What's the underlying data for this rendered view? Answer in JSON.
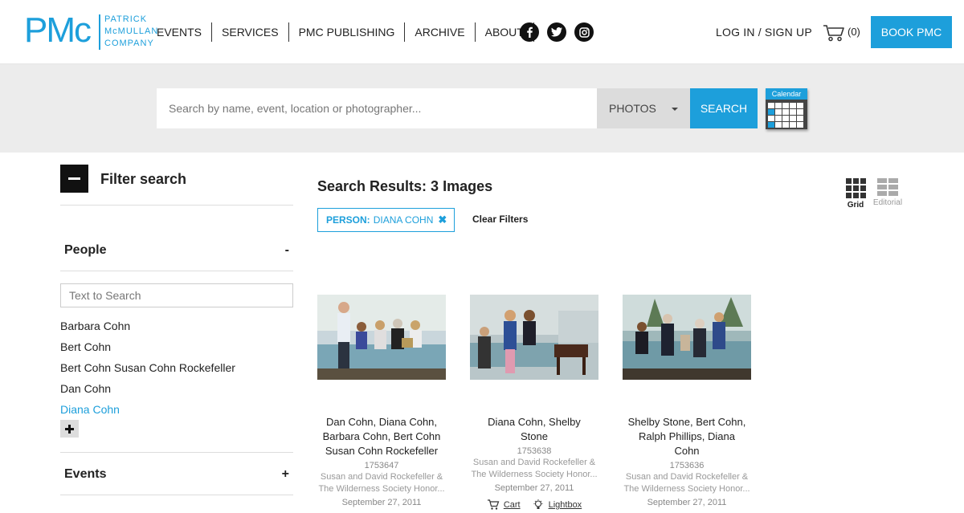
{
  "brand": {
    "logo_mark": "PMc",
    "logo_line1": "PATRICK",
    "logo_line2": "McMULLAN",
    "logo_line3": "COMPANY",
    "accent": "#1d9fdb"
  },
  "nav": {
    "items": [
      "EVENTS",
      "SERVICES",
      "PMC PUBLISHING",
      "ARCHIVE",
      "ABOUT"
    ],
    "social": [
      "facebook-icon",
      "twitter-icon",
      "instagram-icon"
    ],
    "login": "LOG IN / SIGN UP",
    "cart_count": "(0)",
    "book_button": "BOOK PMC"
  },
  "search": {
    "placeholder": "Search by name, event, location or photographer...",
    "type_value": "PHOTOS",
    "button": "SEARCH",
    "calendar_label": "Calendar"
  },
  "sidebar": {
    "filter_title": "Filter search",
    "people": {
      "title": "People",
      "sign": "-",
      "search_placeholder": "Text to Search",
      "items": [
        "Barbara Cohn",
        "Bert Cohn",
        "Bert Cohn Susan Cohn Rockefeller",
        "Dan Cohn",
        "Diana Cohn"
      ]
    },
    "events": {
      "title": "Events",
      "sign": "+"
    }
  },
  "results": {
    "title": "Search Results: 3 Images",
    "chip_label": "PERSON:",
    "chip_value": "DIANA COHN",
    "clear_filters": "Clear Filters",
    "view_grid": "Grid",
    "view_editorial": "Editorial",
    "cards": [
      {
        "names": "Dan Cohn, Diana Cohn, Barbara Cohn, Bert Cohn Susan Cohn Rockefeller",
        "id": "1753647",
        "event_line1": "Susan and David Rockefeller &",
        "event_line2": "The Wilderness Society Honor...",
        "date": "September 27, 2011"
      },
      {
        "names": "Diana Cohn, Shelby Stone",
        "id": "1753638",
        "event_line1": "Susan and David Rockefeller &",
        "event_line2": "The Wilderness Society Honor...",
        "date": "September 27, 2011",
        "cart": "Cart",
        "lightbox": "Lightbox"
      },
      {
        "names": "Shelby Stone, Bert Cohn, Ralph Phillips, Diana Cohn",
        "id": "1753636",
        "event_line1": "Susan and David Rockefeller &",
        "event_line2": "The Wilderness Society Honor...",
        "date": "September 27, 2011"
      }
    ]
  }
}
